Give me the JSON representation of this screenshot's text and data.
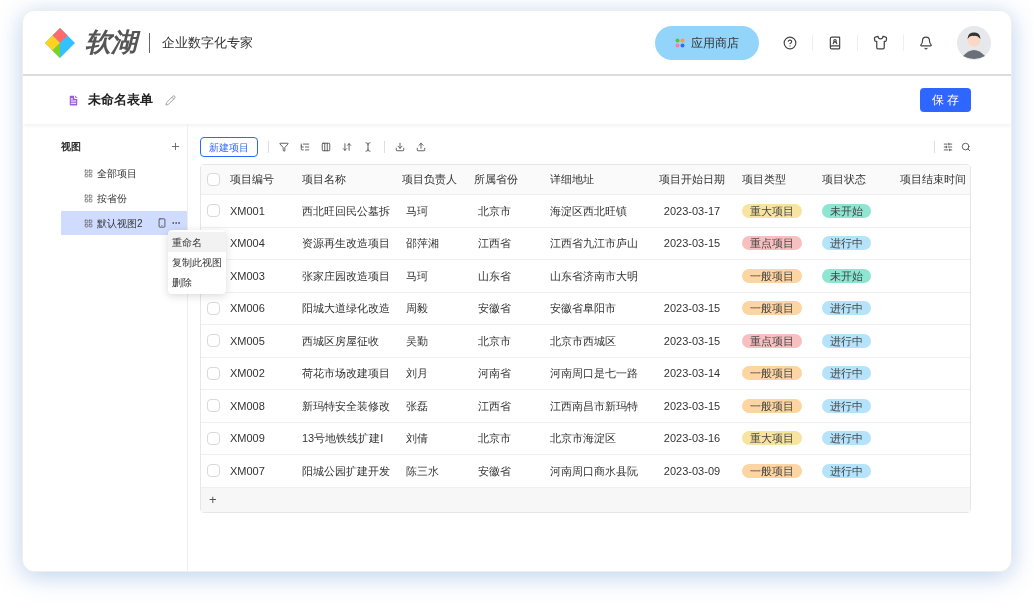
{
  "brand": {
    "name": "软湖",
    "slogan": "企业数字化专家"
  },
  "header": {
    "app_store": "应用商店"
  },
  "form": {
    "title": "未命名表单",
    "save": "保 存"
  },
  "sidebar": {
    "title": "视图",
    "items": [
      {
        "label": "全部项目",
        "selected": false
      },
      {
        "label": "按省份",
        "selected": false
      },
      {
        "label": "默认视图2",
        "selected": true
      }
    ]
  },
  "context_menu": {
    "items": [
      {
        "label": "重命名",
        "selected": true
      },
      {
        "label": "复制此视图",
        "selected": false
      },
      {
        "label": "删除",
        "selected": false
      }
    ]
  },
  "toolbar": {
    "new_button": "新建项目"
  },
  "table": {
    "all_checked": false,
    "columns": [
      "项目编号",
      "项目名称",
      "项目负责人",
      "所属省份",
      "详细地址",
      "项目开始日期",
      "项目类型",
      "项目状态",
      "项目结束时间"
    ],
    "rows": [
      {
        "checked": false,
        "cells": [
          "XM001",
          "西北旺回民公墓拆",
          "马珂",
          "北京市",
          "海淀区西北旺镇",
          "2023-03-17"
        ],
        "type": {
          "text": "重大项目",
          "color": "#f7e4a1"
        },
        "status": {
          "text": "未开始",
          "color": "#8ee6d2"
        }
      },
      {
        "cells": [
          "XM004",
          "资源再生改造项目",
          "邵萍湘",
          "江西省",
          "江西省九江市庐山",
          "2023-03-15"
        ],
        "type": {
          "text": "重点项目",
          "color": "#f8bfc0"
        },
        "status": {
          "text": "进行中",
          "color": "#b4e3fa"
        }
      },
      {
        "cells": [
          "XM003",
          "张家庄园改造项目",
          "马珂",
          "山东省",
          "山东省济南市大明",
          ""
        ],
        "type": {
          "text": "一般项目",
          "color": "#fdd5a2"
        },
        "status": {
          "text": "未开始",
          "color": "#8ee6d2"
        }
      },
      {
        "checked": false,
        "cells": [
          "XM006",
          "阳城大道绿化改造",
          "周毅",
          "安徽省",
          "安徽省阜阳市",
          "2023-03-15"
        ],
        "type": {
          "text": "一般项目",
          "color": "#fdd5a2"
        },
        "status": {
          "text": "进行中",
          "color": "#b4e3fa"
        }
      },
      {
        "checked": false,
        "cells": [
          "XM005",
          "西城区房屋征收",
          "吴勤",
          "北京市",
          "北京市西城区",
          "2023-03-15"
        ],
        "type": {
          "text": "重点项目",
          "color": "#f8bfc0"
        },
        "status": {
          "text": "进行中",
          "color": "#b4e3fa"
        }
      },
      {
        "checked": false,
        "cells": [
          "XM002",
          "荷花市场改建项目",
          "刘月",
          "河南省",
          "河南周口是七一路",
          "2023-03-14"
        ],
        "type": {
          "text": "一般项目",
          "color": "#fdd5a2"
        },
        "status": {
          "text": "进行中",
          "color": "#b4e3fa"
        }
      },
      {
        "checked": false,
        "cells": [
          "XM008",
          "新玛特安全装修改",
          "张磊",
          "江西省",
          "江西南昌市新玛特",
          "2023-03-15"
        ],
        "type": {
          "text": "一般项目",
          "color": "#fdd5a2"
        },
        "status": {
          "text": "进行中",
          "color": "#b4e3fa"
        }
      },
      {
        "checked": false,
        "cells": [
          "XM009",
          "13号地铁线扩建I",
          "刘倩",
          "北京市",
          "北京市海淀区",
          "2023-03-16"
        ],
        "type": {
          "text": "重大项目",
          "color": "#f7e4a1"
        },
        "status": {
          "text": "进行中",
          "color": "#b4e3fa"
        }
      },
      {
        "checked": false,
        "cells": [
          "XM007",
          "阳城公园扩建开发",
          "陈三水",
          "安徽省",
          "河南周口商水县阮",
          "2023-03-09"
        ],
        "type": {
          "text": "一般项目",
          "color": "#fdd5a2"
        },
        "status": {
          "text": "进行中",
          "color": "#b4e3fa"
        }
      }
    ],
    "add": "+"
  }
}
